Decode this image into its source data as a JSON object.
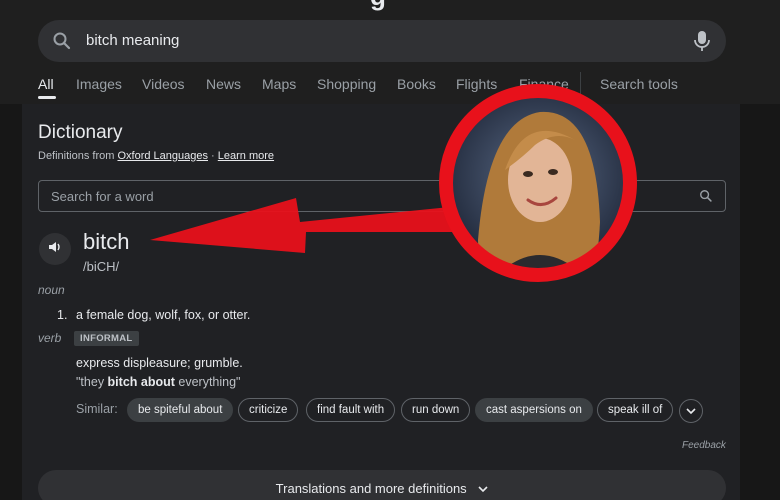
{
  "search": {
    "query": "bitch meaning"
  },
  "tabs": [
    {
      "label": "All",
      "active": true
    },
    {
      "label": "Images"
    },
    {
      "label": "Videos"
    },
    {
      "label": "News"
    },
    {
      "label": "Maps"
    },
    {
      "label": "Shopping"
    },
    {
      "label": "Books"
    },
    {
      "label": "Flights"
    },
    {
      "label": "Finance"
    },
    {
      "label": "Search tools"
    }
  ],
  "dictionary": {
    "title": "Dictionary",
    "source_prefix": "Definitions from ",
    "source_name": "Oxford Languages",
    "source_sep": " · ",
    "learn_more": "Learn more",
    "search_placeholder": "Search for a word",
    "word": "bitch",
    "phonetic": "/biCH/",
    "noun": {
      "pos": "noun",
      "number": "1.",
      "definition": "a female dog, wolf, fox, or otter."
    },
    "verb": {
      "pos": "verb",
      "badge": "INFORMAL",
      "definition": "express displeasure; grumble.",
      "example_open": "\"they ",
      "example_bold": "bitch about",
      "example_close": " everything\""
    },
    "similar_label": "Similar:",
    "similar": [
      {
        "label": "be spiteful about",
        "filled": true
      },
      {
        "label": "criticize"
      },
      {
        "label": "find fault with"
      },
      {
        "label": "run down"
      },
      {
        "label": "cast aspersions on",
        "filled": true
      },
      {
        "label": "speak ill of"
      }
    ],
    "feedback": "Feedback",
    "translations": "Translations and more definitions"
  },
  "colors": {
    "background": "#202124",
    "overlay_red": "#e8111b",
    "text": "#e8eaed"
  }
}
